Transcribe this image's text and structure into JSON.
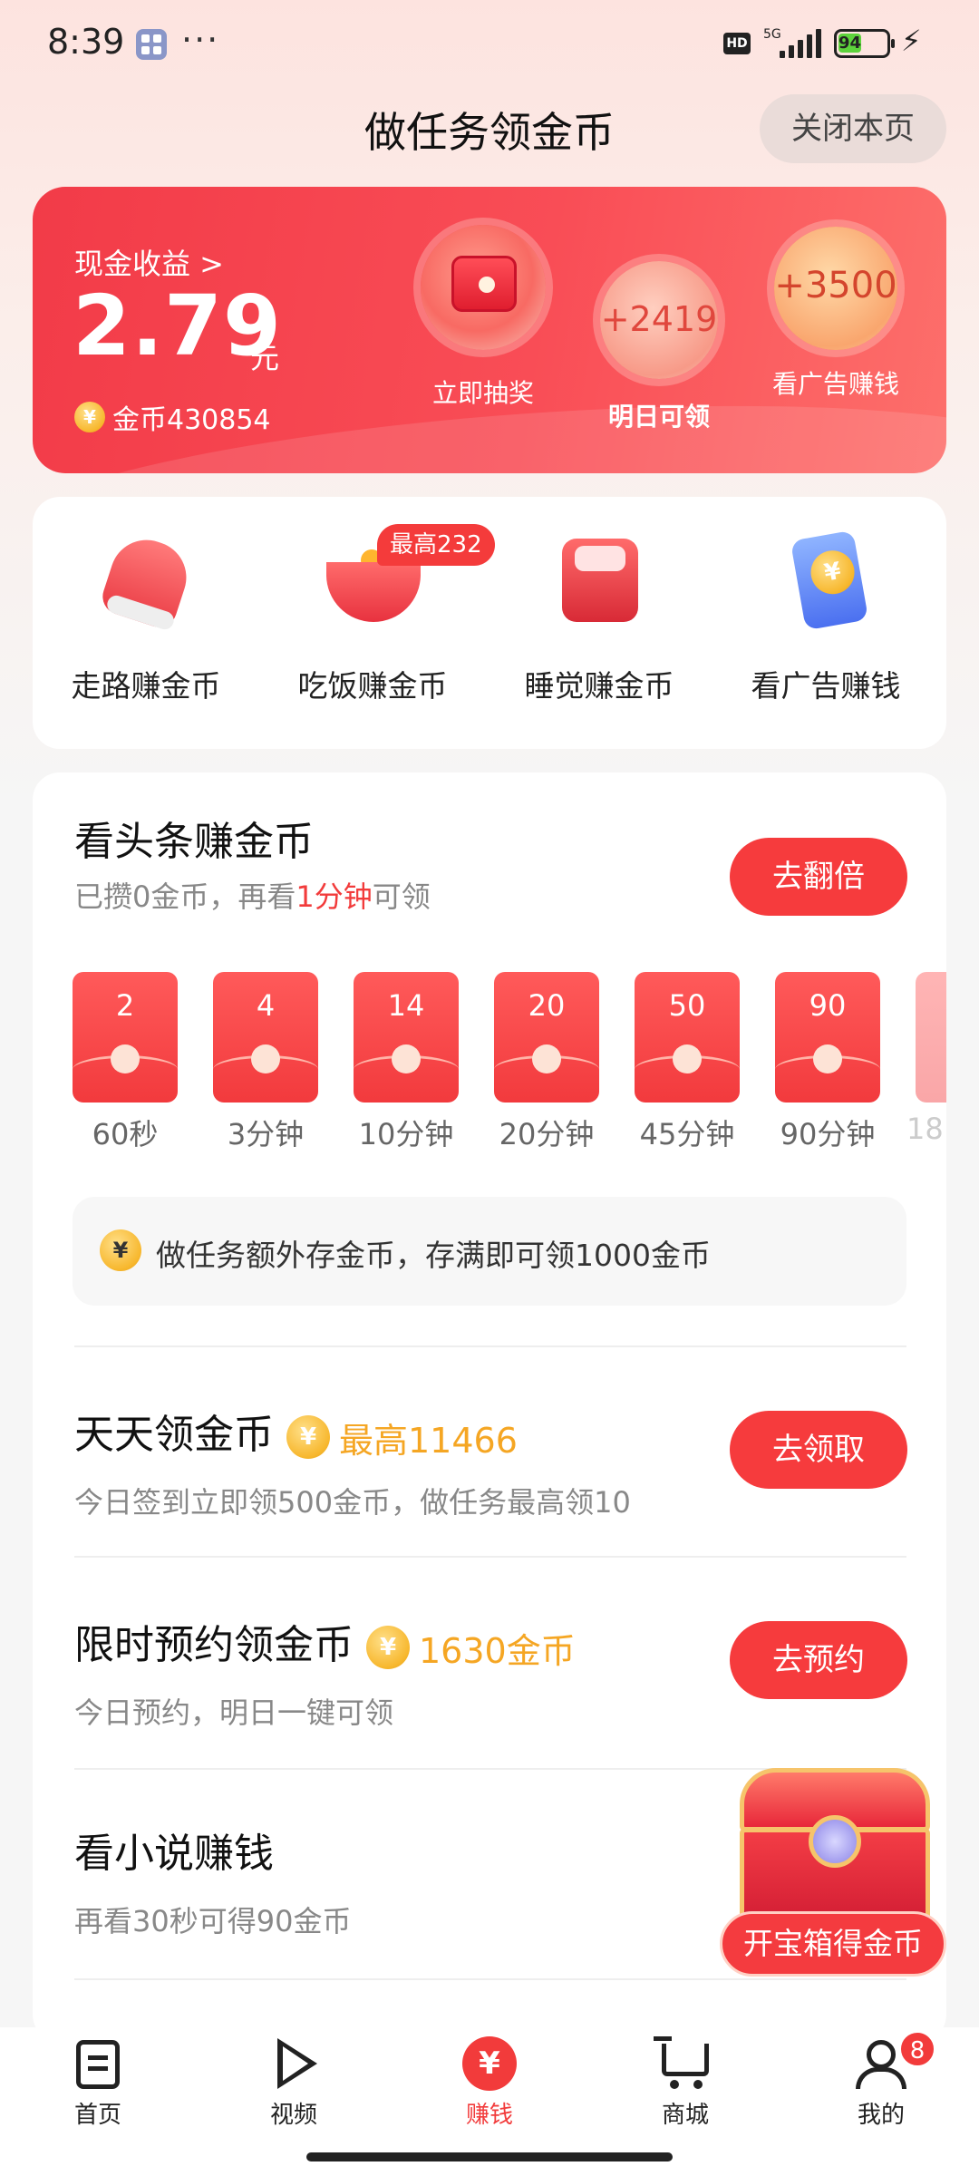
{
  "status_bar": {
    "time": "8:39",
    "network": "5G",
    "battery": "94",
    "hd": "HD"
  },
  "header": {
    "title": "做任务领金币",
    "close_label": "关闭本页"
  },
  "cash_card": {
    "label": "现金收益 >",
    "amount": "2.79",
    "unit": "元",
    "coins_text": "金币430854",
    "lottery_label": "立即抽奖",
    "tomorrow_value": "+2419",
    "tomorrow_label": "明日可领",
    "ad_value": "+3500",
    "ad_label": "看广告赚钱"
  },
  "shortcuts": [
    {
      "label": "走路赚金币",
      "icon": "shoe-icon"
    },
    {
      "label": "吃饭赚金币",
      "icon": "bowl-icon",
      "badge": "最高232"
    },
    {
      "label": "睡觉赚金币",
      "icon": "bed-icon"
    },
    {
      "label": "看广告赚钱",
      "icon": "phone-coin-icon"
    }
  ],
  "news_task": {
    "title": "看头条赚金币",
    "sub_prefix": "已攒0金币，再看",
    "sub_highlight": "1分钟",
    "sub_suffix": "可领",
    "button": "去翻倍",
    "envelopes": [
      {
        "value": "2",
        "time": "60秒"
      },
      {
        "value": "4",
        "time": "3分钟"
      },
      {
        "value": "14",
        "time": "10分钟"
      },
      {
        "value": "20",
        "time": "20分钟"
      },
      {
        "value": "50",
        "time": "45分钟"
      },
      {
        "value": "90",
        "time": "90分钟"
      },
      {
        "value": "",
        "time": "18"
      }
    ],
    "tip": "做任务额外存金币，存满即可领1000金币"
  },
  "daily_task": {
    "title": "天天领金币",
    "highlight": "最高11466",
    "sub": "今日签到立即领500金币，做任务最高领10",
    "button": "去领取"
  },
  "reserve_task": {
    "title": "限时预约领金币",
    "highlight": "1630金币",
    "sub": "今日预约，明日一键可领",
    "button": "去预约"
  },
  "novel_task": {
    "title": "看小说赚钱",
    "sub": "再看30秒可得90金币"
  },
  "chest": {
    "label": "开宝箱得金币"
  },
  "nav": [
    {
      "label": "首页"
    },
    {
      "label": "视频"
    },
    {
      "label": "赚钱"
    },
    {
      "label": "商城"
    },
    {
      "label": "我的",
      "badge": "8"
    }
  ],
  "colors": {
    "accent": "#f23b3b",
    "gold": "#f5a623"
  }
}
